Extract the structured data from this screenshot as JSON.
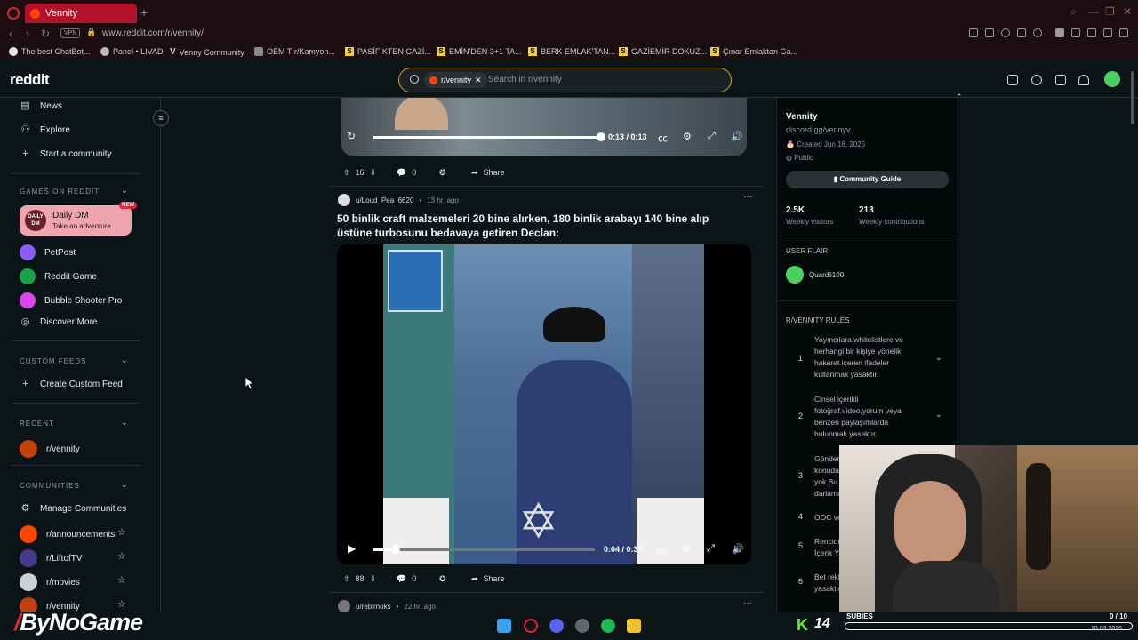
{
  "browser": {
    "tab_title": "Vennity",
    "url": "www.reddit.com/r/vennity/",
    "vpn_label": "VPN",
    "bookmarks": [
      {
        "label": "The best ChatBot...",
        "icon": "chatbot-icon"
      },
      {
        "label": "Panel • LIVAD",
        "icon": "panel-icon"
      },
      {
        "label": "Venny Community",
        "icon": "v-icon"
      },
      {
        "label": "OEM Tır/Kamyon...",
        "icon": "oem-icon"
      },
      {
        "label": "PASİFİKTEN GAZİ...",
        "icon": "s-icon"
      },
      {
        "label": "EMİN'DEN 3+1 TA...",
        "icon": "s-icon"
      },
      {
        "label": "BERK EMLAK'TAN...",
        "icon": "s-icon"
      },
      {
        "label": "GAZİEMİR DOKUZ...",
        "icon": "s-icon"
      },
      {
        "label": "Çınar Emlaktan Ga...",
        "icon": "s-icon"
      }
    ],
    "bookmark_s_letter": "S"
  },
  "reddit": {
    "logo": "reddit",
    "search": {
      "chip": "r/vennity",
      "placeholder": "Search in r/vennity"
    }
  },
  "left_nav": {
    "top_items": [
      {
        "label": "News",
        "icon": "news-icon"
      },
      {
        "label": "Explore",
        "icon": "explore-icon"
      },
      {
        "label": "Start a community",
        "icon": "plus-icon"
      }
    ],
    "games_heading": "GAMES ON REDDIT",
    "daily_dm": {
      "title": "Daily DM",
      "subtitle": "Take an adventure",
      "badge": "NEW",
      "icon_text": "DAILY DM"
    },
    "games": [
      {
        "label": "PetPost",
        "color": "#8b5cf6"
      },
      {
        "label": "Reddit Game",
        "color": "#16a34a"
      },
      {
        "label": "Bubble Shooter Pro",
        "color": "#d946ef"
      },
      {
        "label": "Discover More",
        "color": ""
      }
    ],
    "custom_feeds_heading": "CUSTOM FEEDS",
    "create_custom_feed": "Create Custom Feed",
    "recent_heading": "RECENT",
    "recent": [
      {
        "label": "r/vennity"
      }
    ],
    "communities_heading": "COMMUNITIES",
    "manage_communities": "Manage Communities",
    "communities": [
      {
        "label": "r/announcements",
        "color": "#ff4500"
      },
      {
        "label": "r/LiftofTV",
        "color": "#4b3a8c"
      },
      {
        "label": "r/movies",
        "color": "#cfcfcf"
      },
      {
        "label": "r/vennity",
        "color": "#c2410c"
      }
    ]
  },
  "feed": {
    "post1": {
      "time": "0:13 / 0:13",
      "progress": 1.0,
      "votes": "16",
      "comments": "0",
      "share": "Share"
    },
    "post2": {
      "user": "u/Loud_Pea_6620",
      "age": "13 hr. ago",
      "title": "50 binlik craft malzemeleri 20 bine alırken, 180 binlik arabayı 140 bine alıp üstüne turbosunu bedavaya getiren Declan:",
      "time": "0:04 / 0:38",
      "progress": 0.105,
      "votes": "88",
      "comments": "0",
      "share": "Share"
    },
    "post3": {
      "user": "u/rebirnoks",
      "age": "22 hr. ago"
    }
  },
  "right_sidebar": {
    "name": "Vennity",
    "link": "discord.gg/vennyv",
    "created": "Created Jun 18, 2025",
    "visibility": "Public",
    "guide_button": "Community Guide",
    "stats": [
      {
        "value": "2.5K",
        "label": "Weekly visitors"
      },
      {
        "value": "213",
        "label": "Weekly contributions"
      }
    ],
    "user_flair_heading": "USER FLAIR",
    "user_flair_name": "Quardii100",
    "rules_heading": "R/VENNITY RULES",
    "rules": [
      {
        "num": "1",
        "text": "Yayıncılara.whitelistlere ve herhangi bir kişiye yönelik hakaret içeren ifadeler kullanmak yasaktır."
      },
      {
        "num": "2",
        "text": "Cinsel içerikli fotoğraf.video,yorum veya benzeri paylaşımlarda bulunmak yasaktır."
      },
      {
        "num": "3",
        "text": "Gönder konuda yok.Bu darlama"
      },
      {
        "num": "4",
        "text": "OOC ve"
      },
      {
        "num": "5",
        "text": "Rencide İçerik Ya"
      },
      {
        "num": "6",
        "text": "Bet rekl yasaktır"
      }
    ]
  },
  "overlay": {
    "brand": "ByNoGame",
    "brand_slash": "/",
    "subs_label": "SUBIES",
    "subs_count": "0 / 10",
    "subs_progress": 0.0,
    "clock_date": "10.03.2026",
    "kick_text": "14"
  }
}
